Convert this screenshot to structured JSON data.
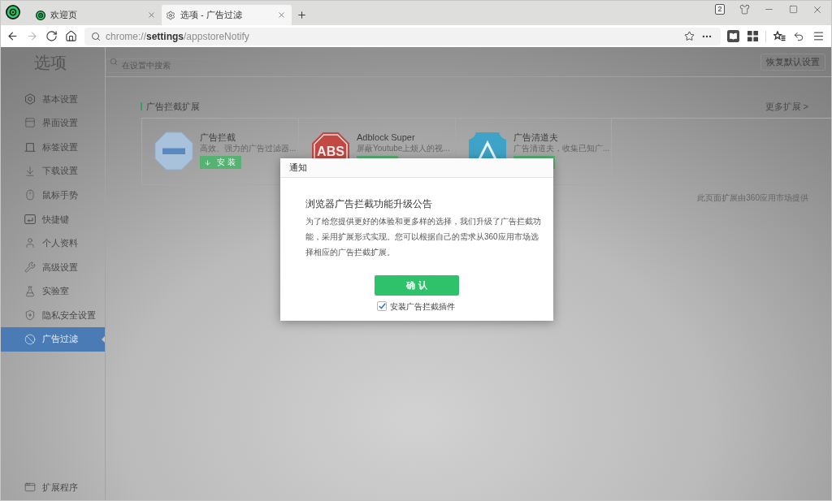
{
  "browser": {
    "tabs": [
      {
        "title": "欢迎页",
        "selected": false
      },
      {
        "title": "选项 - 广告过滤",
        "selected": true
      }
    ],
    "tab_count": "2",
    "nav_buttons": [
      {
        "disabled": false
      },
      {
        "disabled": true
      },
      {
        "disabled": false
      },
      {
        "disabled": false
      }
    ],
    "address": "chrome://**settings**/appstoreNotify"
  },
  "settings": {
    "title": "选项",
    "search": {
      "placeholder": "在设置中搜索"
    },
    "restore_button": "恢复默认设置",
    "sidebar": {
      "items": [
        {
          "label": "基本设置",
          "selected": false
        },
        {
          "label": "界面设置",
          "selected": false
        },
        {
          "label": "标签设置",
          "selected": false
        },
        {
          "label": "下载设置",
          "selected": false
        },
        {
          "label": "鼠标手势",
          "selected": false
        },
        {
          "label": "快捷键",
          "selected": false
        },
        {
          "label": "个人资料",
          "selected": false
        },
        {
          "label": "高级设置",
          "selected": false
        },
        {
          "label": "实验室",
          "selected": false
        },
        {
          "label": "隐私安全设置",
          "selected": false
        },
        {
          "label": "广告过滤",
          "selected": true
        }
      ],
      "footer_item": "扩展程序"
    },
    "section": {
      "title": "广告拦截扩展",
      "more_link": "更多扩展 >",
      "cards": [
        {
          "kind": "no-entry",
          "name": "广告拦截",
          "description": "高效、强力的广告过滤器...",
          "installable": true,
          "install_label": "安 装"
        },
        {
          "kind": "stop-sign",
          "logo_text": "ABS",
          "name": "Adblock Super",
          "description": "屏蔽Youtube上烦人的视...",
          "installable": true
        },
        {
          "kind": "badge",
          "name": "广告清道夫",
          "description": "广告清道夫，收集已知广...",
          "installable": true
        }
      ],
      "footnote": "此页面扩展由360应用市场提供"
    }
  },
  "dialog": {
    "title": "通知",
    "heading": "浏览器广告拦截功能升级公告",
    "body": "为了给您提供更好的体验和更多样的选择，我们升级了广告拦截功能，采用扩展形式实现。您可以根据自己的需求从360应用市场选择相应的广告拦截扩展。",
    "confirm_button": "确 认",
    "checkbox": {
      "label": "安装广告拦截插件",
      "checked": true
    }
  }
}
